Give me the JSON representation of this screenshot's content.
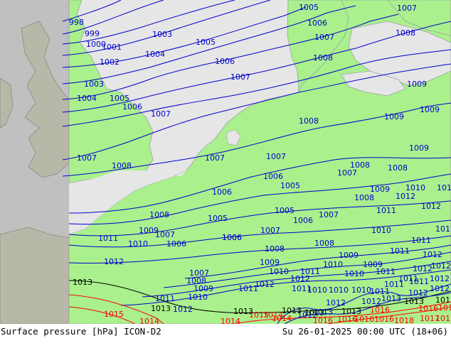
{
  "footer": {
    "left": "Surface pressure [hPa] ICON-D2",
    "right": "Su 26-01-2025 00:00 UTC (18+06)"
  },
  "colors": {
    "sea": "#e6e6e6",
    "land": "#aaf08c",
    "outside_domain": "#c0c0c0",
    "isobar_low": "#0000cd",
    "isobar_ref": "#000000",
    "isobar_high": "#ff0000",
    "coast": "#9aa0a6"
  },
  "isobar_labels": {
    "blue": [
      {
        "text": "998"
      },
      {
        "text": "999"
      },
      {
        "text": "1000"
      },
      {
        "text": "1001"
      },
      {
        "text": "1002"
      },
      {
        "text": "1003"
      },
      {
        "text": "1003"
      },
      {
        "text": "1004"
      },
      {
        "text": "1004"
      },
      {
        "text": "1005"
      },
      {
        "text": "1005"
      },
      {
        "text": "1005"
      },
      {
        "text": "1006"
      },
      {
        "text": "1006"
      },
      {
        "text": "1006"
      },
      {
        "text": "1007"
      },
      {
        "text": "1007"
      },
      {
        "text": "1007"
      },
      {
        "text": "1007"
      },
      {
        "text": "1007"
      },
      {
        "text": "1007"
      },
      {
        "text": "1008"
      },
      {
        "text": "1008"
      },
      {
        "text": "1008"
      },
      {
        "text": "1008"
      },
      {
        "text": "1008"
      },
      {
        "text": "1008"
      },
      {
        "text": "1009"
      },
      {
        "text": "1009"
      },
      {
        "text": "1009"
      },
      {
        "text": "1009"
      },
      {
        "text": "1009"
      },
      {
        "text": "1006"
      },
      {
        "text": "1005"
      },
      {
        "text": "1006"
      },
      {
        "text": "1007"
      },
      {
        "text": "1007"
      },
      {
        "text": "1005"
      },
      {
        "text": "1006"
      },
      {
        "text": "1008"
      },
      {
        "text": "1009"
      },
      {
        "text": "1008"
      },
      {
        "text": "1012"
      },
      {
        "text": "1011"
      },
      {
        "text": "1012"
      },
      {
        "text": "1010"
      },
      {
        "text": "1007"
      },
      {
        "text": "1006"
      },
      {
        "text": "1010"
      },
      {
        "text": "1011"
      },
      {
        "text": "1011"
      },
      {
        "text": "1012"
      },
      {
        "text": "1005"
      },
      {
        "text": "1007"
      },
      {
        "text": "1006"
      },
      {
        "text": "1008"
      },
      {
        "text": "1006"
      },
      {
        "text": "1007"
      },
      {
        "text": "1010"
      },
      {
        "text": "1011"
      },
      {
        "text": "1012"
      },
      {
        "text": "1007"
      },
      {
        "text": "1008"
      },
      {
        "text": "1009"
      },
      {
        "text": "1010"
      },
      {
        "text": "1011"
      },
      {
        "text": "1012"
      },
      {
        "text": "1008"
      },
      {
        "text": "1009"
      },
      {
        "text": "1010"
      },
      {
        "text": "1011"
      },
      {
        "text": "1012"
      },
      {
        "text": "1009"
      },
      {
        "text": "1010"
      },
      {
        "text": "1011"
      },
      {
        "text": "1012"
      },
      {
        "text": "1009"
      },
      {
        "text": "1010"
      },
      {
        "text": "1011"
      },
      {
        "text": "1012"
      },
      {
        "text": "1011"
      },
      {
        "text": "1012"
      },
      {
        "text": "1012"
      },
      {
        "text": "1013"
      },
      {
        "text": "1010"
      },
      {
        "text": "1010"
      },
      {
        "text": "1011"
      },
      {
        "text": "1010"
      },
      {
        "text": "1011"
      },
      {
        "text": "1011"
      },
      {
        "text": "1012"
      },
      {
        "text": "1011"
      },
      {
        "text": "1012"
      },
      {
        "text": "1012"
      },
      {
        "text": "1012"
      },
      {
        "text": "1012"
      },
      {
        "text": "1012"
      },
      {
        "text": "1013"
      },
      {
        "text": "1013"
      }
    ],
    "black": [
      {
        "text": "1013"
      },
      {
        "text": "1013"
      },
      {
        "text": "1013"
      },
      {
        "text": "1013"
      },
      {
        "text": "1013"
      },
      {
        "text": "1013"
      },
      {
        "text": "1013"
      },
      {
        "text": "1013"
      }
    ],
    "red": [
      {
        "text": "1015"
      },
      {
        "text": "1014"
      },
      {
        "text": "1014"
      },
      {
        "text": "1015"
      },
      {
        "text": "1016"
      },
      {
        "text": "1016"
      },
      {
        "text": "1016"
      },
      {
        "text": "1016"
      },
      {
        "text": "1016"
      },
      {
        "text": "1017"
      },
      {
        "text": "1018"
      },
      {
        "text": "1016"
      },
      {
        "text": "1016"
      },
      {
        "text": "1017"
      },
      {
        "text": "1014"
      },
      {
        "text": "1014"
      }
    ]
  }
}
